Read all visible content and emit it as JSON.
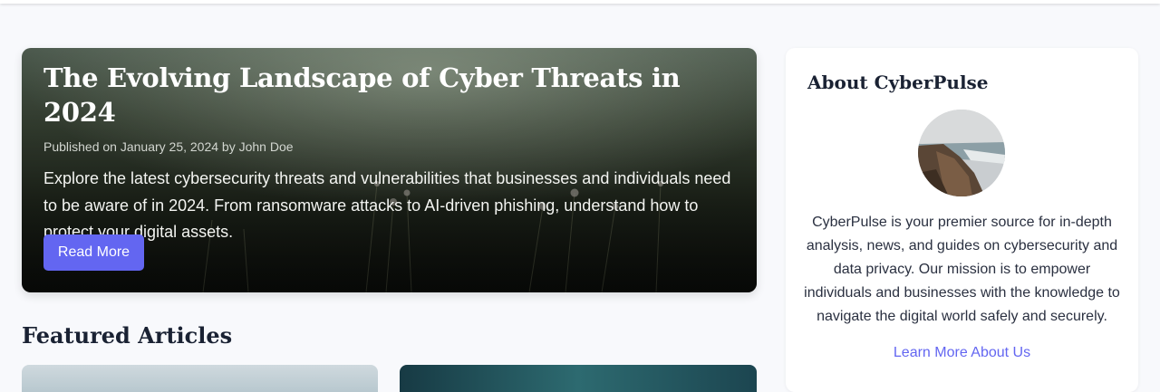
{
  "hero": {
    "title": "The Evolving Landscape of Cyber Threats in 2024",
    "meta": "Published on January 25, 2024 by John Doe",
    "description": "Explore the latest cybersecurity threats and vulnerabilities that businesses and individuals need to be aware of in 2024. From ransomware attacks to AI-driven phishing, understand how to protect your digital assets.",
    "button_label": "Read More"
  },
  "featured": {
    "title": "Featured Articles"
  },
  "sidebar": {
    "title": "About CyberPulse",
    "description": "CyberPulse is your premier source for in-depth analysis, news, and guides on cybersecurity and data privacy. Our mission is to empower individuals and businesses with the knowledge to navigate the digital world safely and securely.",
    "link_label": "Learn More About Us"
  },
  "colors": {
    "accent": "#6366f1",
    "heading": "#1a2233",
    "background": "#f8f9fc"
  }
}
